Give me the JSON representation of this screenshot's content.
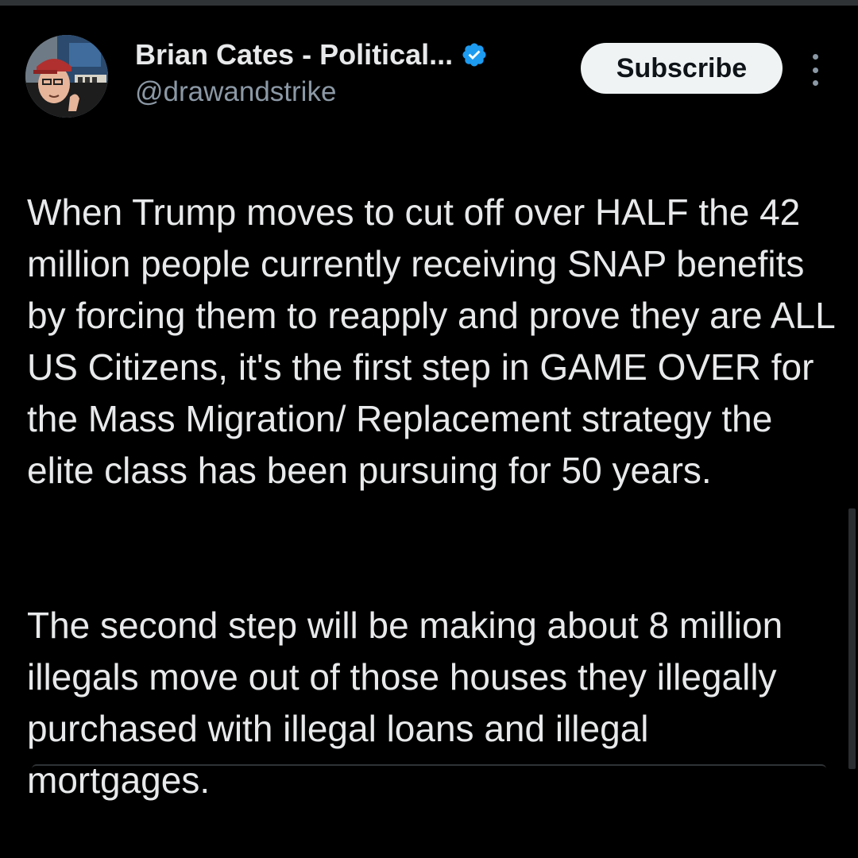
{
  "post": {
    "author": {
      "display_name": "Brian Cates - Political...",
      "handle": "@drawandstrike",
      "verified": true,
      "verified_icon": "verified-badge-icon",
      "avatar_icon": "profile-photo"
    },
    "subscribe_label": "Subscribe",
    "more_icon": "more-vertical-icon",
    "paragraphs": [
      "When Trump moves to cut off over HALF the 42 million people currently receiving SNAP benefits by forcing them to reapply and prove they are ALL US Citizens, it's the first step in GAME OVER for the Mass Migration/ Replacement strategy the elite class has been pursuing for 50 years.",
      "The second step will be making about 8 million illegals move out of those houses they illegally purchased with illegal loans and illegal mortgages."
    ]
  },
  "colors": {
    "background": "#000000",
    "text": "#e7e9ea",
    "secondary_text": "#8b98a5",
    "verified_blue": "#1d9bf0",
    "button_bg": "#eff3f4"
  }
}
